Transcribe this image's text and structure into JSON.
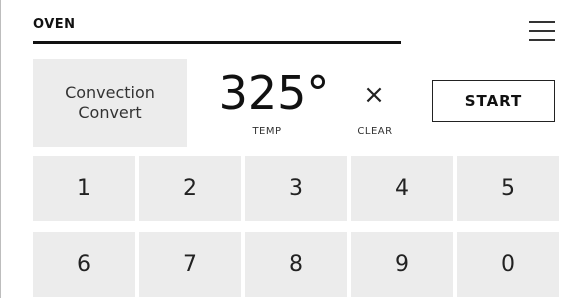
{
  "header": {
    "title": "OVEN"
  },
  "menu": {
    "icon": "hamburger-menu-icon"
  },
  "mode": {
    "label": "Convection Convert"
  },
  "temperature": {
    "value": "325°",
    "label": "TEMP"
  },
  "clear": {
    "icon_glyph": "×",
    "label": "CLEAR"
  },
  "start": {
    "label": "START"
  },
  "keypad": {
    "keys": [
      "1",
      "2",
      "3",
      "4",
      "5",
      "6",
      "7",
      "8",
      "9",
      "0"
    ]
  }
}
